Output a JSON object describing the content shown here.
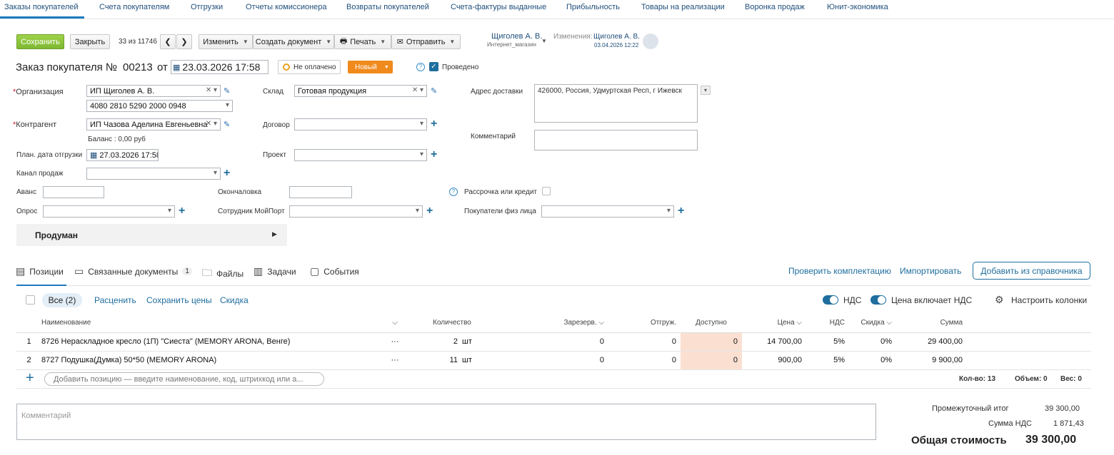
{
  "topnav": {
    "tabs": [
      "Заказы покупателей",
      "Счета покупателям",
      "Отгрузки",
      "Отчеты комиссионера",
      "Возвраты покупателей",
      "Счета-фактуры выданные",
      "Прибыльность",
      "Товары на реализации",
      "Воронка продаж",
      "Юнит-экономика"
    ]
  },
  "toolbar": {
    "save": "Сохранить",
    "close": "Закрыть",
    "counter": "33 из 11746",
    "change": "Изменить",
    "create_doc": "Создать документ",
    "print": "Печать",
    "send": "Отправить",
    "owner_name": "Щиголев А. В.",
    "owner_sub": "Интернет_магазин",
    "changed_label": "Изменения:",
    "changed_name": "Щиголев А. В.",
    "changed_date": "03.04.2026 12:22"
  },
  "header": {
    "title": "Заказ покупателя №",
    "number": "00213",
    "from": "от",
    "datetime": "23.03.2026 17:58",
    "payment_status": "Не оплачено",
    "status": "Новый",
    "posted": "Проведено"
  },
  "form": {
    "org_label": "Организация",
    "org_value": "ИП Щиголев А. В.",
    "account_value": "4080 2810 5290 2000 0948",
    "counterparty_label": "Контрагент",
    "counterparty_value": "ИП Чазова Аделина Евгеньевна",
    "balance": "Баланс : 0,00 руб",
    "ship_date_label": "План. дата отгрузки",
    "ship_date_value": "27.03.2026 17:58",
    "channel_label": "Канал продаж",
    "warehouse_label": "Склад",
    "warehouse_value": "Готовая продукция",
    "contract_label": "Договор",
    "project_label": "Проект",
    "address_label": "Адрес доставки",
    "address_value": "426000, Россия, Удмуртская Респ, г Ижевск",
    "comment_label": "Комментарий",
    "advance_label": "Аванс",
    "final_label": "Окончаловка",
    "installment_label": "Рассрочка или кредит",
    "survey_label": "Опрос",
    "employee_label": "Сотрудник МойПорт",
    "buyers_label": "Покупатели физ лица",
    "section_title": "Продуман"
  },
  "tabs": {
    "positions": "Позиции",
    "linked_docs": "Связанные документы",
    "linked_count": "1",
    "files": "Файлы",
    "tasks": "Задачи",
    "events": "События",
    "check_kit": "Проверить комплектацию",
    "import": "Импортировать",
    "add_from_ref": "Добавить из справочника"
  },
  "positions_toolbar": {
    "all": "Все (2)",
    "reprice": "Расценить",
    "save_prices": "Сохранить цены",
    "discount": "Скидка",
    "vat": "НДС",
    "price_incl_vat": "Цена включает НДС",
    "configure": "Настроить колонки"
  },
  "table": {
    "headers": [
      "Наименование",
      "Количество",
      "Зарезерв.",
      "Отгруж.",
      "Доступно",
      "Цена",
      "НДС",
      "Скидка",
      "Сумма"
    ],
    "rows": [
      {
        "n": "1",
        "name": "8726 Нераскладное кресло (1П) \"Сиеста\" (MEMORY ARONA, Венге)",
        "qty": "2",
        "unit": "шт",
        "reserved": "0",
        "shipped": "0",
        "available": "0",
        "price": "14 700,00",
        "vat": "5%",
        "discount": "0%",
        "sum": "29 400,00"
      },
      {
        "n": "2",
        "name": "8727 Подушка(Думка) 50*50 (MEMORY ARONA)",
        "qty": "11",
        "unit": "шт",
        "reserved": "0",
        "shipped": "0",
        "available": "0",
        "price": "900,00",
        "vat": "5%",
        "discount": "0%",
        "sum": "9 900,00"
      }
    ],
    "add_placeholder": "Добавить позицию — введите наименование, код, штрихкод или а...",
    "qty_total": "Кол-во: 13",
    "volume": "Объем: 0",
    "weight": "Вес: 0"
  },
  "totals": {
    "comment_placeholder": "Комментарий",
    "subtotal_label": "Промежуточный итог",
    "subtotal": "39 300,00",
    "vat_label": "Сумма НДС",
    "vat": "1 871,43",
    "total_label": "Общая стоимость",
    "total": "39 300,00"
  },
  "colors": {
    "accent": "#1f6e9e",
    "save": "#8bc43a",
    "status": "#f08a1c",
    "available_bg": "#fbe0d2"
  }
}
